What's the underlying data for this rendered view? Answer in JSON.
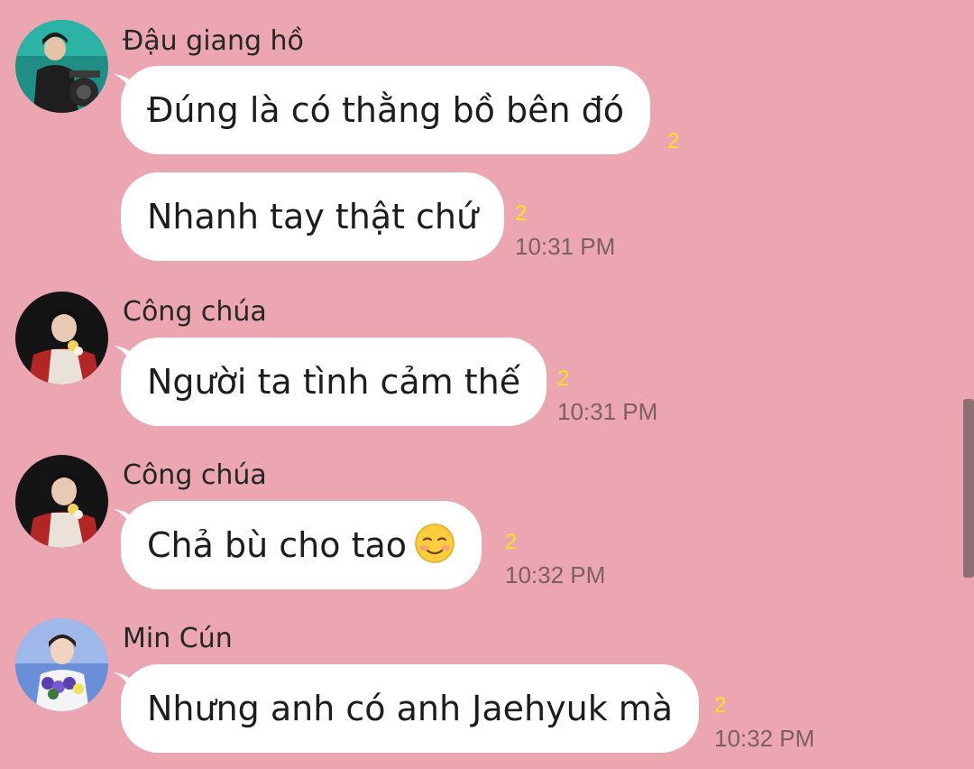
{
  "conversation": {
    "messages": [
      {
        "sender": "Đậu giang hồ",
        "text": "Đúng là có thằng bồ bên đó",
        "read_count": "2",
        "time": ""
      },
      {
        "sender": "",
        "text": "Nhanh tay thật chứ",
        "read_count": "2",
        "time": "10:31 PM"
      },
      {
        "sender": "Công chúa",
        "text": "Người ta tình cảm thế",
        "read_count": "2",
        "time": "10:31 PM"
      },
      {
        "sender": "Công chúa",
        "text": "Chả bù cho tao",
        "emoji": "smiling-face-emoji",
        "read_count": "2",
        "time": "10:32 PM"
      },
      {
        "sender": "Min Cún",
        "text": "Nhưng anh có anh Jaehyuk mà",
        "read_count": "2",
        "time": "10:32 PM"
      }
    ]
  },
  "colors": {
    "background": "#eca6b1",
    "bubble": "#ffffff",
    "read_count": "#f4e41a",
    "timestamp": "#7c5f63"
  }
}
